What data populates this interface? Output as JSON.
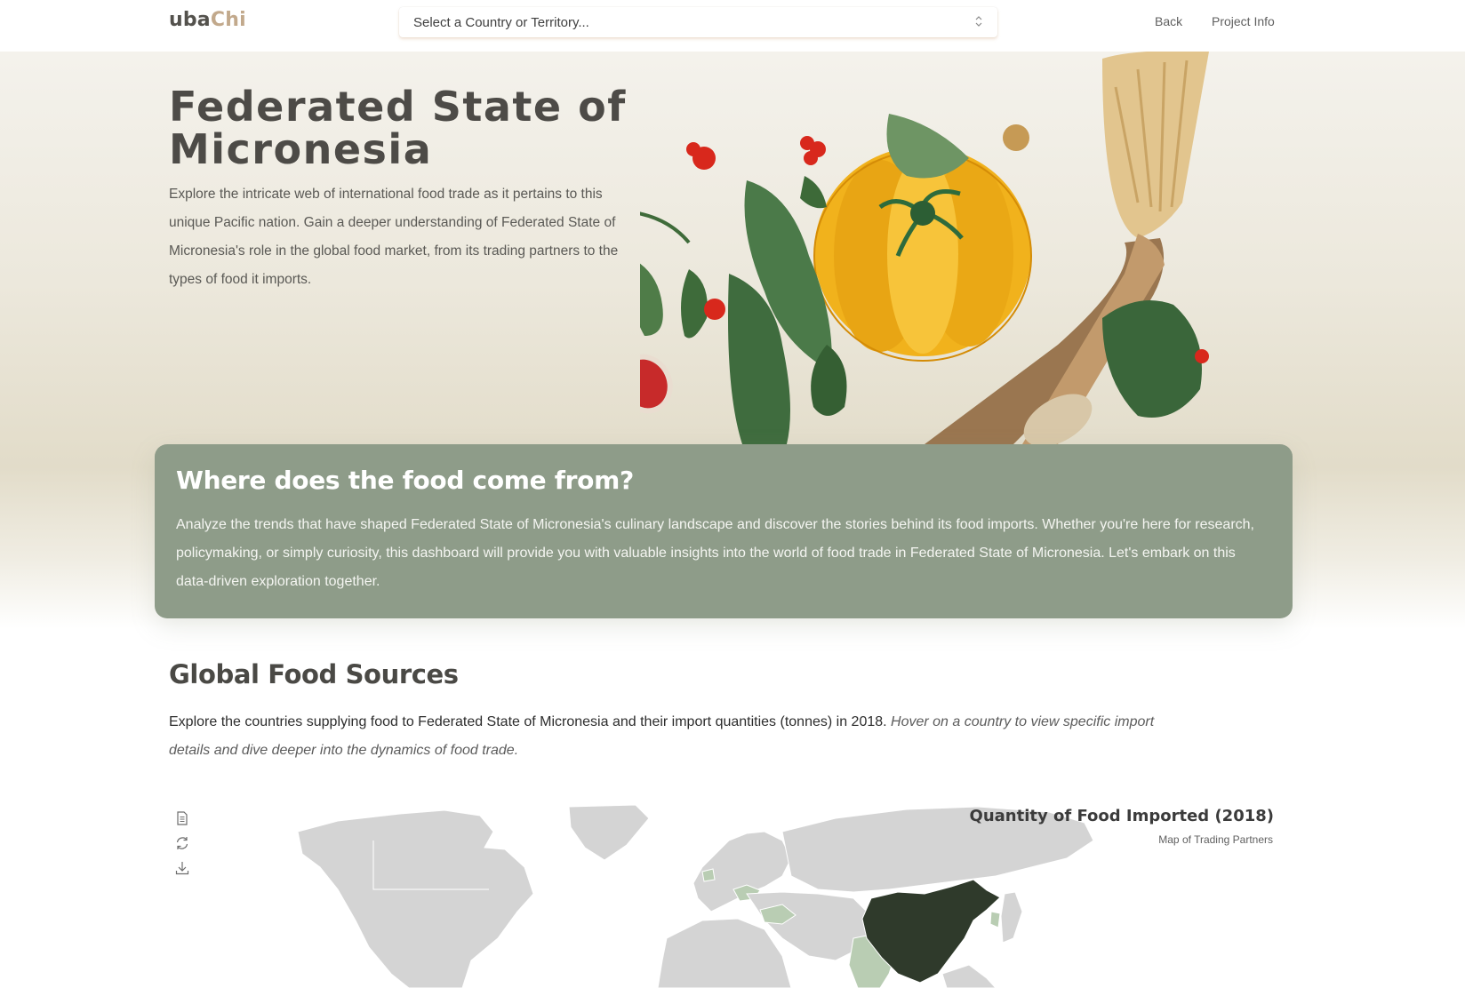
{
  "nav": {
    "logo_part1": "uba",
    "logo_part2": "Chi",
    "country_select_placeholder": "Select a Country or Territory...",
    "back_label": "Back",
    "project_info_label": "Project Info"
  },
  "hero": {
    "title": "Federated State of Micronesia",
    "description": "Explore the intricate web of international food trade as it pertains to this unique Pacific nation. Gain a deeper understanding of Federated State of Micronesia's role in the global food market, from its trading partners to the types of food it imports."
  },
  "intro": {
    "heading": "Where does the food come from?",
    "body": "Analyze the trends that have shaped Federated State of Micronesia's culinary landscape and discover the stories behind its food imports. Whether you're here for research, policymaking, or simply curiosity, this dashboard will provide you with valuable insights into the world of food trade in Federated State of Micronesia. Let's embark on this data-driven exploration together."
  },
  "sources": {
    "title": "Global Food Sources",
    "description": "Explore the countries supplying food to Federated State of Micronesia and their import quantities (tonnes) in 2018.",
    "hint": "Hover on a country to view specific import details and dive deeper into the dynamics of food trade."
  },
  "map": {
    "title": "Quantity of Food Imported (2018)",
    "subtitle": "Map of Trading Partners",
    "tools": [
      "data-view-icon",
      "refresh-icon",
      "download-icon"
    ]
  },
  "colors": {
    "brand_dark": "#54524d",
    "brand_accent": "#c2a98c",
    "card_green": "#8e9c89",
    "map_land": "#d4d4d4",
    "map_light_partner": "#b9cdb3",
    "map_top_partner": "#2f3a2b"
  }
}
